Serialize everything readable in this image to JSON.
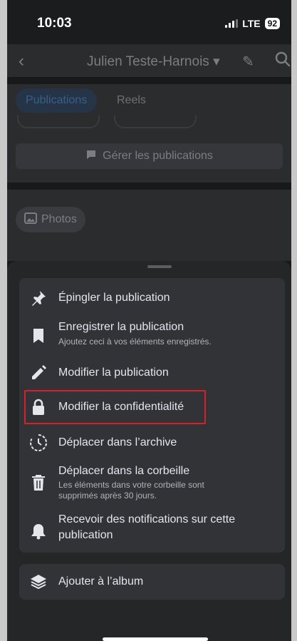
{
  "status": {
    "time": "10:03",
    "network": "LTE",
    "battery": "92"
  },
  "nav": {
    "profile_name": "Julien Teste-Harnois ▾"
  },
  "tabs": [
    {
      "label": "Publications"
    },
    {
      "label": "Reels"
    }
  ],
  "manage_posts_label": "Gérer les publications",
  "photos_label": "Photos",
  "menu": {
    "items": [
      {
        "label": "Épingler la publication",
        "icon": "pin-icon"
      },
      {
        "label": "Enregistrer la publication",
        "sub": "Ajoutez ceci à vos éléments enregistrés.",
        "icon": "bookmark-icon"
      },
      {
        "label": "Modifier la publication",
        "icon": "pencil-icon"
      },
      {
        "label": "Modifier la confidentialité",
        "icon": "lock-icon"
      },
      {
        "label": "Déplacer dans l’archive",
        "icon": "archive-clock-icon"
      },
      {
        "label": "Déplacer dans la corbeille",
        "sub": "Les éléments dans votre corbeille sont",
        "sub2": "supprimés après 30 jours.",
        "icon": "trash-icon"
      },
      {
        "label": "Recevoir des notifications sur cette",
        "label2": "publication",
        "icon": "bell-icon"
      }
    ],
    "album": {
      "label": "Ajouter à l’album",
      "icon": "layers-icon"
    }
  },
  "colors": {
    "highlight": "#d9202a",
    "accent": "#2d88ff"
  }
}
